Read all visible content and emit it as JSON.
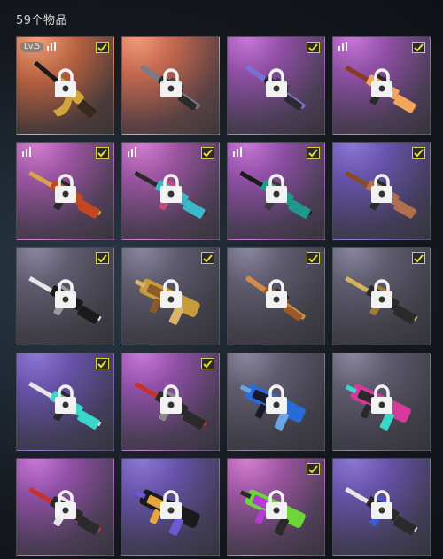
{
  "inventory": {
    "count_label": "59个物品",
    "items": [
      {
        "bg": "bg-orange",
        "checked": true,
        "level": "Lv.5",
        "bars": true,
        "weapon": "rifle-gold",
        "colors": [
          "#1a1a1a",
          "#d2a53a",
          "#3a2a1e"
        ]
      },
      {
        "bg": "bg-red",
        "checked": false,
        "level": "",
        "bars": false,
        "weapon": "sniper",
        "colors": [
          "#2a2a2a",
          "#7a7a88",
          "#4a4250"
        ]
      },
      {
        "bg": "bg-purple",
        "checked": true,
        "level": "",
        "bars": false,
        "weapon": "sniper",
        "colors": [
          "#2a2a30",
          "#7d6fd1",
          "#44384f"
        ]
      },
      {
        "bg": "bg-purple",
        "checked": true,
        "level": "",
        "bars": true,
        "weapon": "rifle",
        "colors": [
          "#8a3a22",
          "#f4a65b",
          "#2a2a2a"
        ]
      },
      {
        "bg": "bg-pink",
        "checked": true,
        "level": "",
        "bars": true,
        "weapon": "rifle",
        "colors": [
          "#d9a34b",
          "#c2481f",
          "#2a2a2a"
        ]
      },
      {
        "bg": "bg-pink",
        "checked": true,
        "level": "",
        "bars": true,
        "weapon": "rifle",
        "colors": [
          "#2a2a2a",
          "#3bb8c9",
          "#c64a7a"
        ]
      },
      {
        "bg": "bg-purple",
        "checked": true,
        "level": "",
        "bars": true,
        "weapon": "rifle",
        "colors": [
          "#1a1a1a",
          "#1f9a8a",
          "#3a3a3a"
        ]
      },
      {
        "bg": "bg-violet",
        "checked": true,
        "level": "",
        "bars": false,
        "weapon": "rifle",
        "colors": [
          "#8a4a22",
          "#b07050",
          "#2a2a2a"
        ]
      },
      {
        "bg": "bg-grey",
        "checked": true,
        "level": "",
        "bars": false,
        "weapon": "rifle",
        "colors": [
          "#e6e6e6",
          "#1a1a1a",
          "#9a9a9a"
        ]
      },
      {
        "bg": "bg-grey",
        "checked": true,
        "level": "",
        "bars": false,
        "weapon": "smg",
        "colors": [
          "#c99a3a",
          "#8a5a2a",
          "#d9b46a"
        ]
      },
      {
        "bg": "bg-grey",
        "checked": true,
        "level": "",
        "bars": false,
        "weapon": "sniper",
        "colors": [
          "#9a5a2a",
          "#d08a4a",
          "#2a2a2a"
        ]
      },
      {
        "bg": "bg-grey",
        "checked": true,
        "level": "",
        "bars": false,
        "weapon": "rifle",
        "colors": [
          "#d6b25a",
          "#2a2a2a",
          "#a07a3a"
        ]
      },
      {
        "bg": "bg-violet",
        "checked": true,
        "level": "",
        "bars": false,
        "weapon": "rifle",
        "colors": [
          "#e6e6e6",
          "#3ad6c9",
          "#2a2a2a"
        ]
      },
      {
        "bg": "bg-purple",
        "checked": true,
        "level": "",
        "bars": false,
        "weapon": "rifle",
        "colors": [
          "#c9302a",
          "#2a2a2a",
          "#8a8a8a"
        ]
      },
      {
        "bg": "bg-grey",
        "checked": false,
        "level": "",
        "bars": false,
        "weapon": "smg",
        "colors": [
          "#2a6ad6",
          "#1a1a2a",
          "#6aa6e6"
        ]
      },
      {
        "bg": "bg-grey",
        "checked": false,
        "level": "",
        "bars": false,
        "weapon": "smg",
        "colors": [
          "#d63a9a",
          "#2a2a2a",
          "#3ad6c9"
        ]
      },
      {
        "bg": "bg-purple",
        "checked": false,
        "level": "",
        "bars": false,
        "weapon": "rifle",
        "colors": [
          "#c9302a",
          "#2a2a2a",
          "#e6e6e6"
        ]
      },
      {
        "bg": "bg-violet",
        "checked": false,
        "level": "",
        "bars": false,
        "weapon": "smg",
        "colors": [
          "#1a1a1a",
          "#e6a63a",
          "#6a5ad6"
        ]
      },
      {
        "bg": "bg-pink",
        "checked": true,
        "level": "",
        "bars": false,
        "weapon": "smg",
        "colors": [
          "#6ad63a",
          "#b63ad6",
          "#2a2a2a"
        ]
      },
      {
        "bg": "bg-violet",
        "checked": false,
        "level": "",
        "bars": false,
        "weapon": "rifle",
        "colors": [
          "#e6e6e6",
          "#2a2a2a",
          "#3a5ad6"
        ]
      }
    ]
  }
}
